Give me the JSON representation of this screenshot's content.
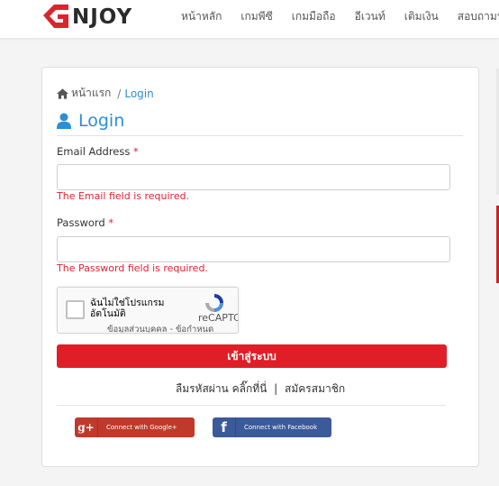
{
  "brand": {
    "name": "NJOY"
  },
  "nav": {
    "items": [
      "หน้าหลัก",
      "เกมพีซี",
      "เกมมือถือ",
      "อีเวนท์",
      "เติมเงิน",
      "สอบถามปั"
    ]
  },
  "breadcrumb": {
    "home": "หน้าแรก",
    "separator": "/",
    "current": "Login"
  },
  "page_title": "Login",
  "form": {
    "email_label": "Email Address",
    "email_required": "*",
    "email_value": "",
    "email_error": "The Email field is required.",
    "password_label": "Password",
    "password_required": "*",
    "password_value": "",
    "password_error": "The Password field is required."
  },
  "recaptcha": {
    "label": "ฉันไม่ใช่โปรแกรมอัตโนมัติ",
    "brand": "reCAPTC",
    "terms": "ข้อมูลส่วนบุคคล - ข้อกำหนด"
  },
  "login_button": "เข้าสู่ระบบ",
  "links": {
    "forgot": "ลืมรหัสผ่าน คลิ๊กที่นี่",
    "divider": "|",
    "register": "สมัครสมาชิก"
  },
  "social": {
    "google_icon": "g+",
    "google_label": "Connect with Google+",
    "facebook_icon": "f",
    "facebook_label": "Connect with Facebook"
  },
  "colors": {
    "accent": "#2a8fd6",
    "primary_button": "#e01e27",
    "error": "#d9262c",
    "google": "#c0392b",
    "facebook": "#3b5a99"
  }
}
